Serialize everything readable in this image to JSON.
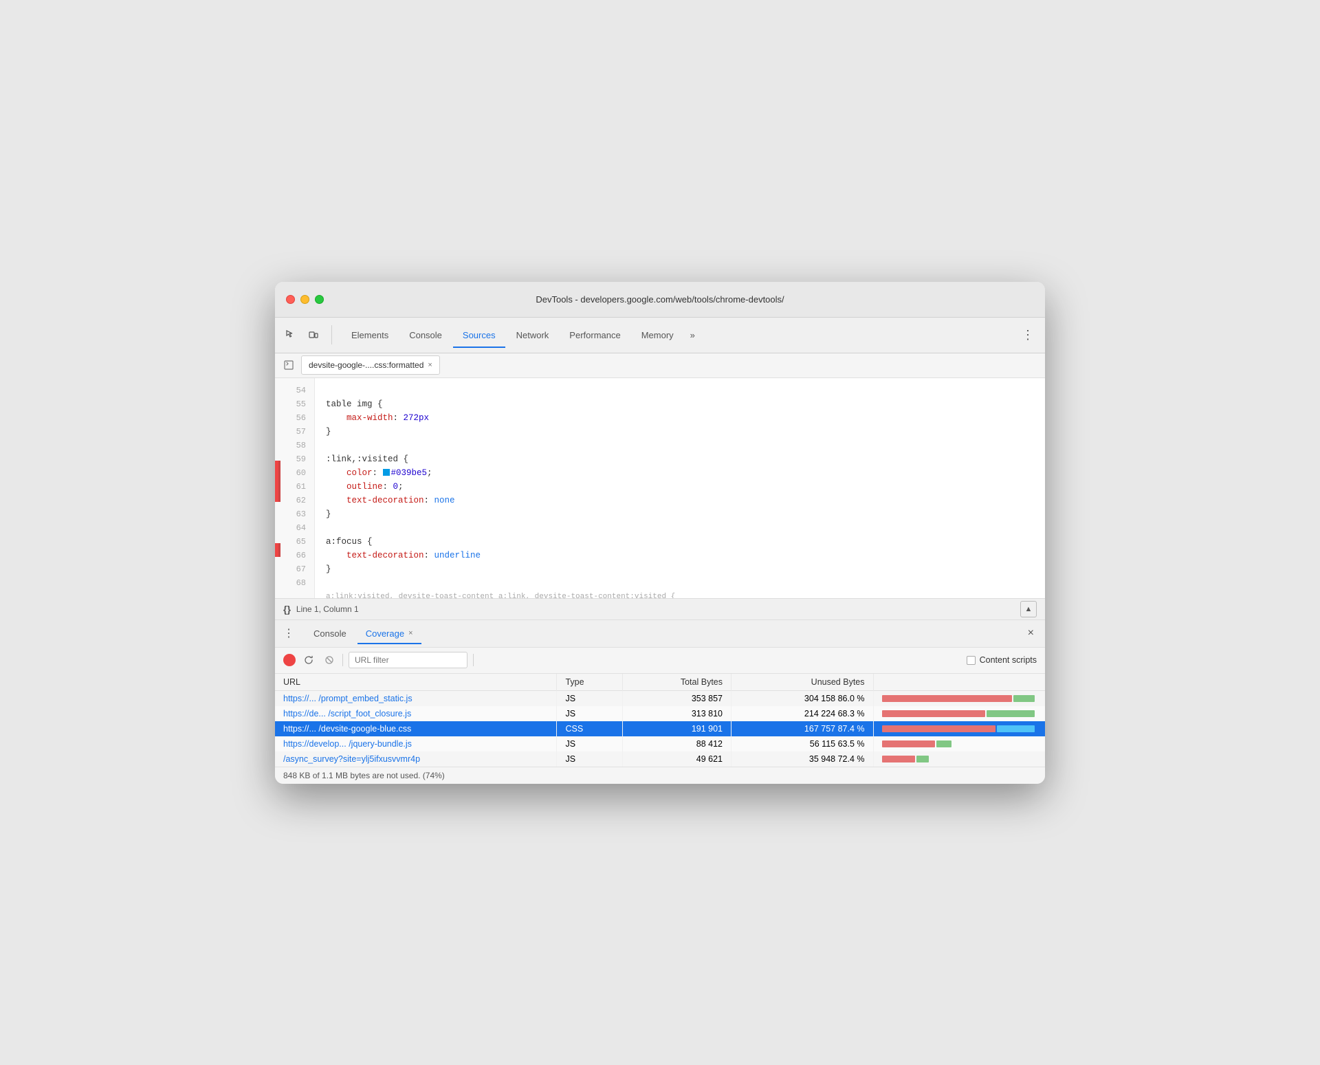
{
  "window": {
    "title": "DevTools - developers.google.com/web/tools/chrome-devtools/"
  },
  "tabs": {
    "items": [
      {
        "id": "elements",
        "label": "Elements",
        "active": false
      },
      {
        "id": "console",
        "label": "Console",
        "active": false
      },
      {
        "id": "sources",
        "label": "Sources",
        "active": true
      },
      {
        "id": "network",
        "label": "Network",
        "active": false
      },
      {
        "id": "performance",
        "label": "Performance",
        "active": false
      },
      {
        "id": "memory",
        "label": "Memory",
        "active": false
      }
    ],
    "more_label": "»",
    "menu_label": "⋮"
  },
  "file_tab": {
    "name": "devsite-google-....css:formatted",
    "close": "×"
  },
  "code": {
    "lines": [
      {
        "num": 54,
        "has_break": false,
        "content": ""
      },
      {
        "num": 55,
        "has_break": false,
        "content_plain": "table img {"
      },
      {
        "num": 56,
        "has_break": false,
        "prop": "    max-width:",
        "val": " 272px"
      },
      {
        "num": 57,
        "has_break": false,
        "content_plain": "}"
      },
      {
        "num": 58,
        "has_break": false,
        "content": ""
      },
      {
        "num": 59,
        "has_break": false,
        "content_plain": ":link,:visited {"
      },
      {
        "num": 60,
        "has_break": true,
        "prop": "    color:",
        "swatch": true,
        "val": " #039be5",
        "val_semi": ";"
      },
      {
        "num": 61,
        "has_break": true,
        "prop": "    outline:",
        "val": " 0",
        "val_semi": ";"
      },
      {
        "num": 62,
        "has_break": true,
        "prop": "    text-decoration:",
        "val_blue": " none"
      },
      {
        "num": 63,
        "has_break": false,
        "content_plain": "}"
      },
      {
        "num": 64,
        "has_break": false,
        "content": ""
      },
      {
        "num": 65,
        "has_break": false,
        "content_plain": "a:focus {"
      },
      {
        "num": 66,
        "has_break": true,
        "prop": "    text-decoration:",
        "val_blue": " underline"
      },
      {
        "num": 67,
        "has_break": false,
        "content_plain": "}"
      },
      {
        "num": 68,
        "has_break": false,
        "content": ""
      }
    ],
    "truncated_line": "a:link:visited, devsite-toast-content a:link, devsite-toast-content:visited {"
  },
  "status_bar": {
    "braces": "{}",
    "position": "Line 1, Column 1",
    "icon": "▲"
  },
  "bottom_panel": {
    "tabs": [
      {
        "id": "console",
        "label": "Console",
        "active": false,
        "closeable": false
      },
      {
        "id": "coverage",
        "label": "Coverage",
        "active": true,
        "closeable": true
      }
    ],
    "close_label": "×"
  },
  "coverage_toolbar": {
    "url_filter_placeholder": "URL filter",
    "content_scripts_label": "Content scripts"
  },
  "coverage_table": {
    "headers": [
      "URL",
      "Type",
      "Total Bytes",
      "Unused Bytes",
      ""
    ],
    "rows": [
      {
        "url": "https://... /prompt_embed_static.js",
        "type": "JS",
        "total_bytes": "353 857",
        "unused_bytes": "304 158",
        "unused_pct": "86.0 %",
        "selected": false,
        "bar_unused_pct": 86,
        "bar_used_pct": 14
      },
      {
        "url": "https://de... /script_foot_closure.js",
        "type": "JS",
        "total_bytes": "313 810",
        "unused_bytes": "214 224",
        "unused_pct": "68.3 %",
        "selected": false,
        "bar_unused_pct": 68,
        "bar_used_pct": 32
      },
      {
        "url": "https://... /devsite-google-blue.css",
        "type": "CSS",
        "total_bytes": "191 901",
        "unused_bytes": "167 757",
        "unused_pct": "87.4 %",
        "selected": true,
        "bar_unused_pct": 75,
        "bar_used_pct": 25
      },
      {
        "url": "https://develop... /jquery-bundle.js",
        "type": "JS",
        "total_bytes": "88 412",
        "unused_bytes": "56 115",
        "unused_pct": "63.5 %",
        "selected": false,
        "bar_unused_pct": 35,
        "bar_used_pct": 10
      },
      {
        "url": "/async_survey?site=ylj5ifxusvvmr4p",
        "type": "JS",
        "total_bytes": "49 621",
        "unused_bytes": "35 948",
        "unused_pct": "72.4 %",
        "selected": false,
        "bar_unused_pct": 22,
        "bar_used_pct": 8
      }
    ],
    "footer": "848 KB of 1.1 MB bytes are not used. (74%)"
  }
}
